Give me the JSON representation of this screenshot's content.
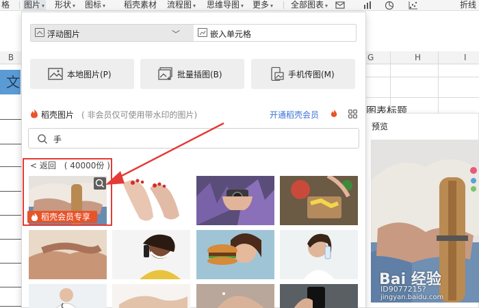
{
  "ribbon": {
    "items": [
      {
        "label": "格",
        "caret": false
      },
      {
        "label": "图片",
        "caret": true
      },
      {
        "label": "形状",
        "caret": true
      },
      {
        "label": "图标",
        "caret": true
      },
      {
        "label": "稻壳素材",
        "caret": false
      },
      {
        "label": "流程图",
        "caret": true
      },
      {
        "label": "思维导图",
        "caret": true
      },
      {
        "label": "更多",
        "caret": true
      },
      {
        "label": "全部图表",
        "caret": true
      },
      {
        "label": "折线",
        "caret": false
      }
    ],
    "caret_glyph": "▾"
  },
  "sheet": {
    "col_headers": [
      "B",
      "G",
      "H",
      "I"
    ],
    "cell_b_text": "文室",
    "title_fragment": "图表标题"
  },
  "panel": {
    "mode_float": "浮动图片",
    "mode_embed": "嵌入单元格",
    "mode_chevron": "﹀",
    "sources": [
      {
        "label": "本地图片(P)",
        "icon": "image-icon"
      },
      {
        "label": "批量插图(B)",
        "icon": "batch-image-icon"
      },
      {
        "label": "手机传图(M)",
        "icon": "phone-image-icon"
      }
    ],
    "brand_label": "稻壳图片",
    "brand_note": "( 非会员仅可使用带水印的图片)",
    "member_link": "开通稻壳会员",
    "search_value": "手",
    "back_label": "< 返回",
    "count": "( 40000份 )",
    "vip_badge": "稻壳会员专享"
  },
  "preview": {
    "title": "预览",
    "watermark_main": "Bai 经验",
    "watermark_id": "ID9077215?",
    "watermark_site": "jingyan.baidu.com"
  },
  "colors": {
    "accent_blue": "#3a73d6",
    "highlight_red": "#e53935",
    "vip_orange": "#e8542a",
    "cell_blue": "#5b9bd5"
  }
}
